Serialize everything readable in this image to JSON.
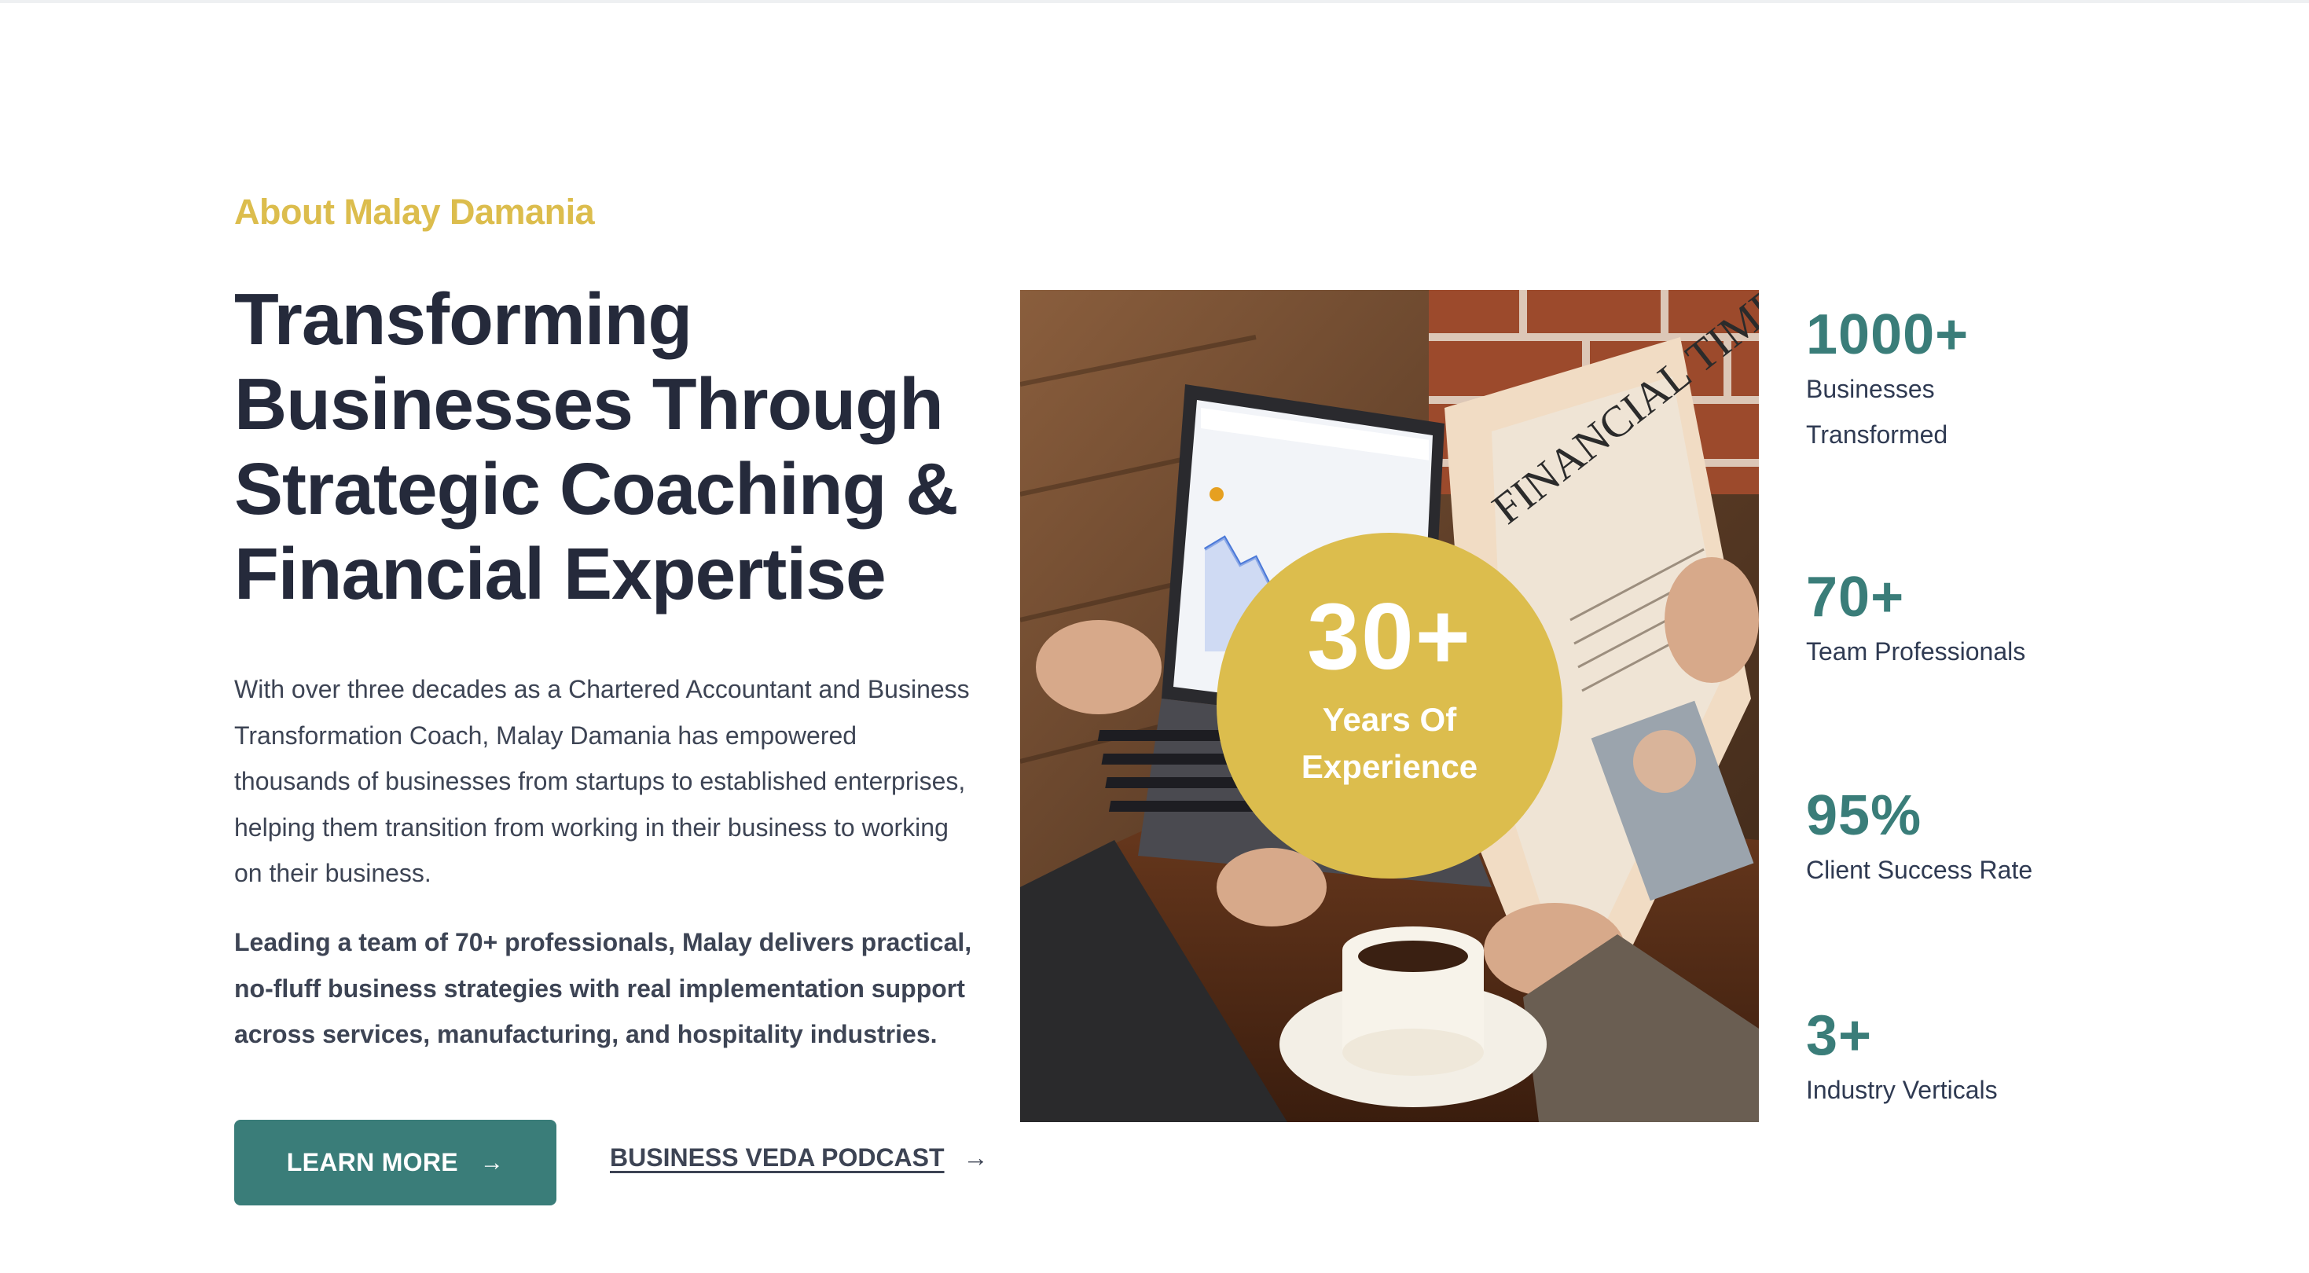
{
  "about": {
    "eyebrow": "About Malay Damania",
    "headline": "Transforming Businesses Through Strategic Coaching & Financial Expertise",
    "paragraph1": "With over three decades as a Chartered Accountant and Business Transformation Coach, Malay Damania has empowered thousands of businesses from startups to established enterprises, helping them transition from working in their business to working on their business.",
    "paragraph2": "Leading a team of 70+ professionals, Malay delivers practical, no-fluff business strategies with real implementation support across services, manufacturing, and hospitality industries."
  },
  "actions": {
    "learn_more_label": "LEARN MORE",
    "learn_more_arrow": "→",
    "podcast_label": "BUSINESS VEDA PODCAST",
    "podcast_arrow": "→"
  },
  "badge": {
    "value": "30+",
    "label_line1": "Years Of",
    "label_line2": "Experience"
  },
  "photo": {
    "newspaper_masthead": "FINANCIAL TIMES"
  },
  "stats": [
    {
      "value": "1000+",
      "caption": "Businesses Transformed"
    },
    {
      "value": "70+",
      "caption": "Team Professionals"
    },
    {
      "value": "95%",
      "caption": "Client Success Rate"
    },
    {
      "value": "3+",
      "caption": "Industry Verticals"
    }
  ],
  "colors": {
    "accent_gold": "#dcbd4d",
    "accent_teal": "#3a7d79",
    "heading": "#252a3b",
    "body_text": "#3d4454"
  }
}
